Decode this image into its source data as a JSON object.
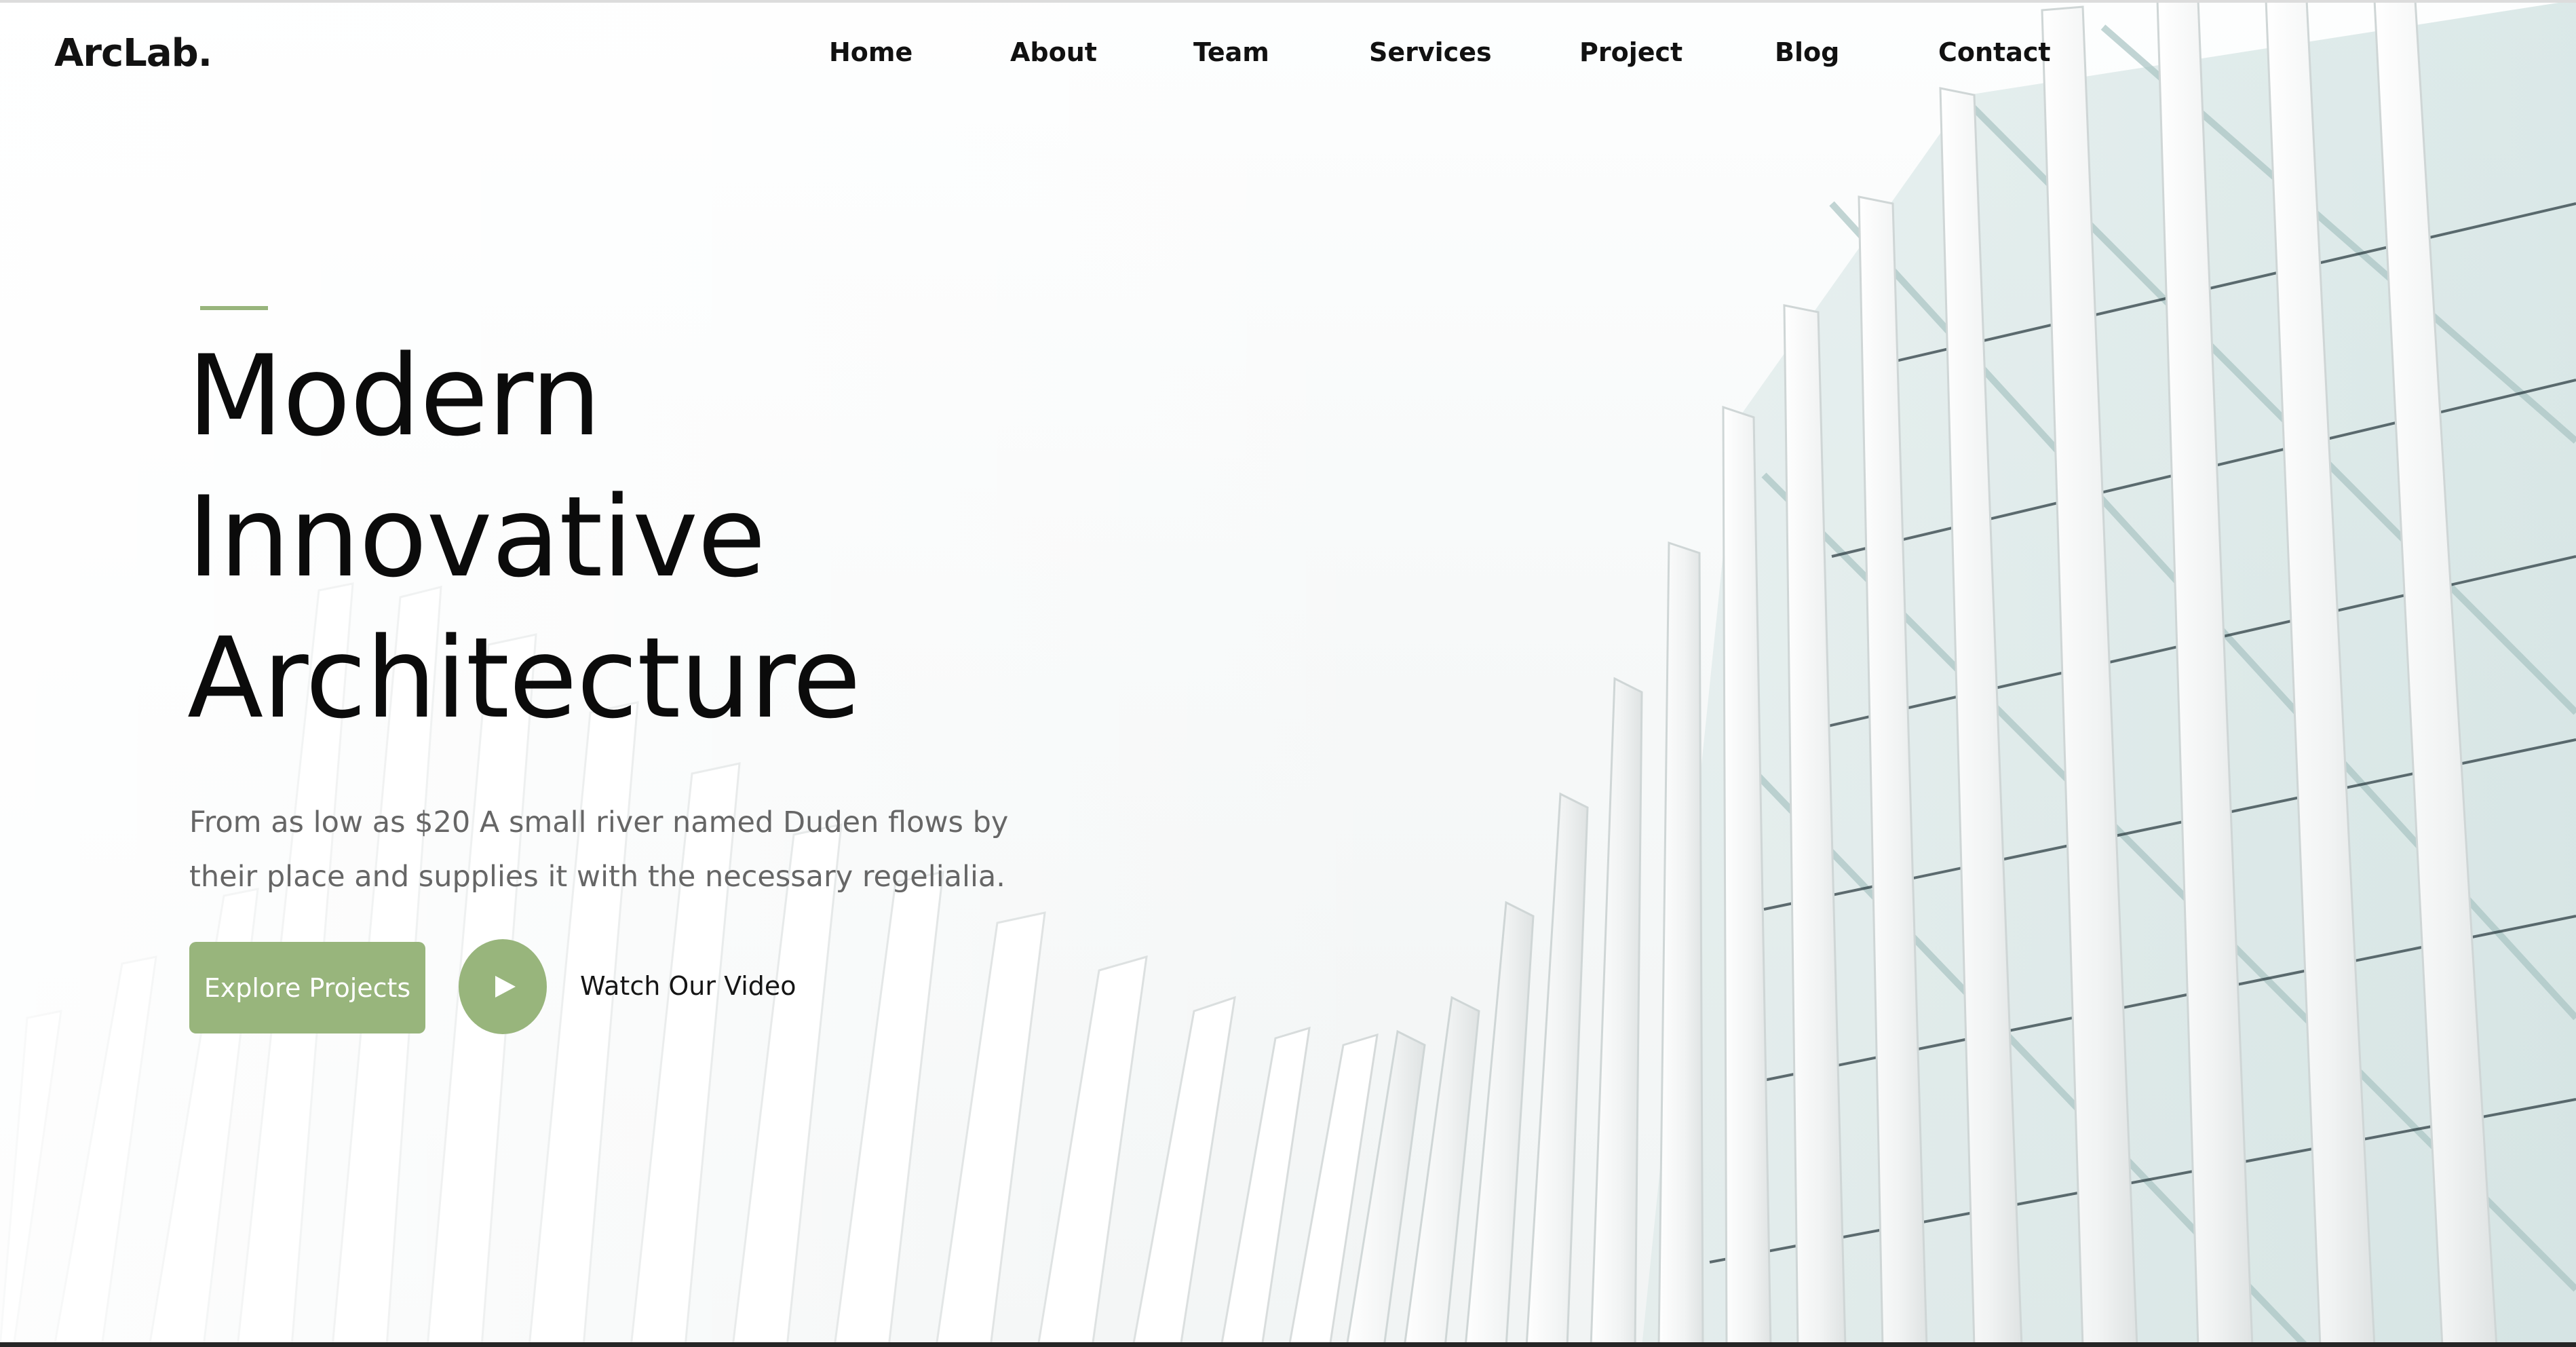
{
  "brand": {
    "logo": "ArcLab."
  },
  "nav": {
    "items": [
      {
        "label": "Home"
      },
      {
        "label": "About"
      },
      {
        "label": "Team"
      },
      {
        "label": "Services"
      },
      {
        "label": "Project"
      },
      {
        "label": "Blog"
      },
      {
        "label": "Contact"
      }
    ]
  },
  "hero": {
    "headline": [
      "Modern",
      "Innovative",
      "Architecture"
    ],
    "subtitle": "From as low as $20 A small river named Duden flows by their place and supplies it with the necessary regelialia.",
    "primary_cta": "Explore Projects",
    "video_cta": "Watch Our Video"
  },
  "colors": {
    "accent": "#98b57c",
    "text_dark": "#111111",
    "text_muted": "#666666"
  },
  "icons": {
    "play": "play-icon"
  }
}
